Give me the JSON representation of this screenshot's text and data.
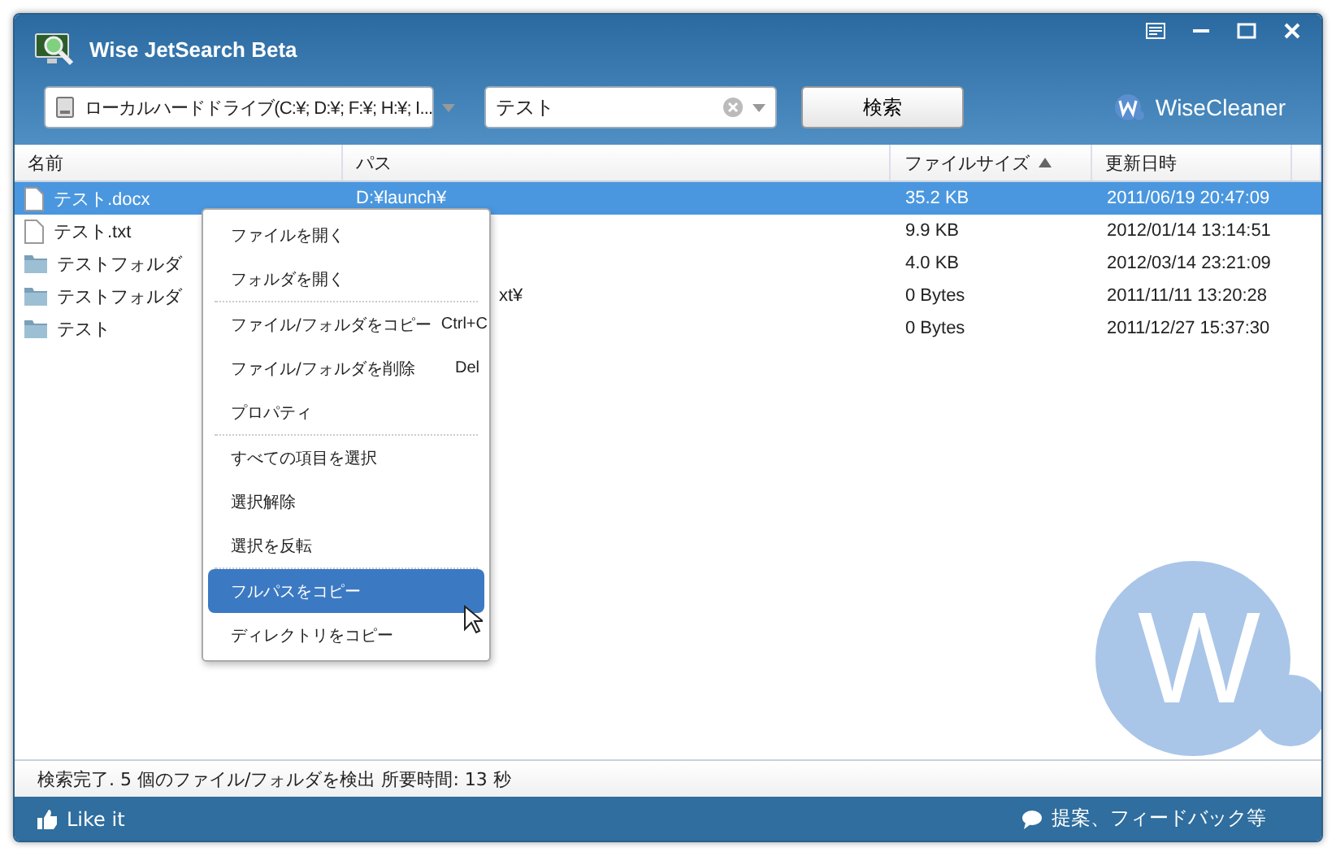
{
  "window": {
    "title": "Wise JetSearch Beta"
  },
  "toolbar": {
    "drive": {
      "value": "ローカルハードドライブ(C:¥; D:¥; F:¥; H:¥; I..."
    },
    "search": {
      "value": "テスト"
    },
    "search_button": "検索",
    "brand": "WiseCleaner"
  },
  "table": {
    "columns": [
      {
        "label": "名前",
        "sorted": false
      },
      {
        "label": "パス",
        "sorted": false
      },
      {
        "label": "ファイルサイズ",
        "sorted": true
      },
      {
        "label": "更新日時",
        "sorted": false
      }
    ],
    "rows": [
      {
        "kind": "file",
        "name": "テスト.docx",
        "path": "D:¥launch¥",
        "size": "35.2 KB",
        "modified": "2011/06/19 20:47:09",
        "selected": true
      },
      {
        "kind": "file",
        "name": "テスト.txt",
        "size": "9.9 KB",
        "modified": "2012/01/14 13:14:51",
        "selected": false
      },
      {
        "kind": "folder",
        "name": "テストフォルダ",
        "size": "4.0 KB",
        "modified": "2012/03/14 23:21:09",
        "selected": false
      },
      {
        "kind": "folder",
        "name": "テストフォルダ",
        "path_tail": "xt¥",
        "size": "0 Bytes",
        "modified": "2011/11/11 13:20:28",
        "selected": false
      },
      {
        "kind": "folder",
        "name": "テスト",
        "size": "0 Bytes",
        "modified": "2011/12/27 15:37:30",
        "selected": false
      }
    ]
  },
  "logo_mark": "W",
  "context_menu": {
    "groups": [
      [
        {
          "label": "ファイルを開く",
          "selected": false
        },
        {
          "label": "フォルダを開く",
          "selected": false
        }
      ],
      [
        {
          "label": "ファイル/フォルダをコピー",
          "shortcut": "Ctrl+C",
          "selected": false
        },
        {
          "label": "ファイル/フォルダを削除",
          "shortcut": "Del",
          "selected": false
        },
        {
          "label": "プロパティ",
          "selected": false
        }
      ],
      [
        {
          "label": "すべての項目を選択",
          "selected": false
        },
        {
          "label": "選択解除",
          "selected": false
        },
        {
          "label": "選択を反転",
          "selected": false
        }
      ],
      [
        {
          "label": "フルパスをコピー",
          "selected": true
        },
        {
          "label": "ディレクトリをコピー",
          "selected": false
        }
      ]
    ]
  },
  "status_bar": "検索完了. 5 個のファイル/フォルダを検出 所要時間: 13 秒",
  "footer": {
    "like": "Like it",
    "feedback": "提案、フィードバック等"
  }
}
